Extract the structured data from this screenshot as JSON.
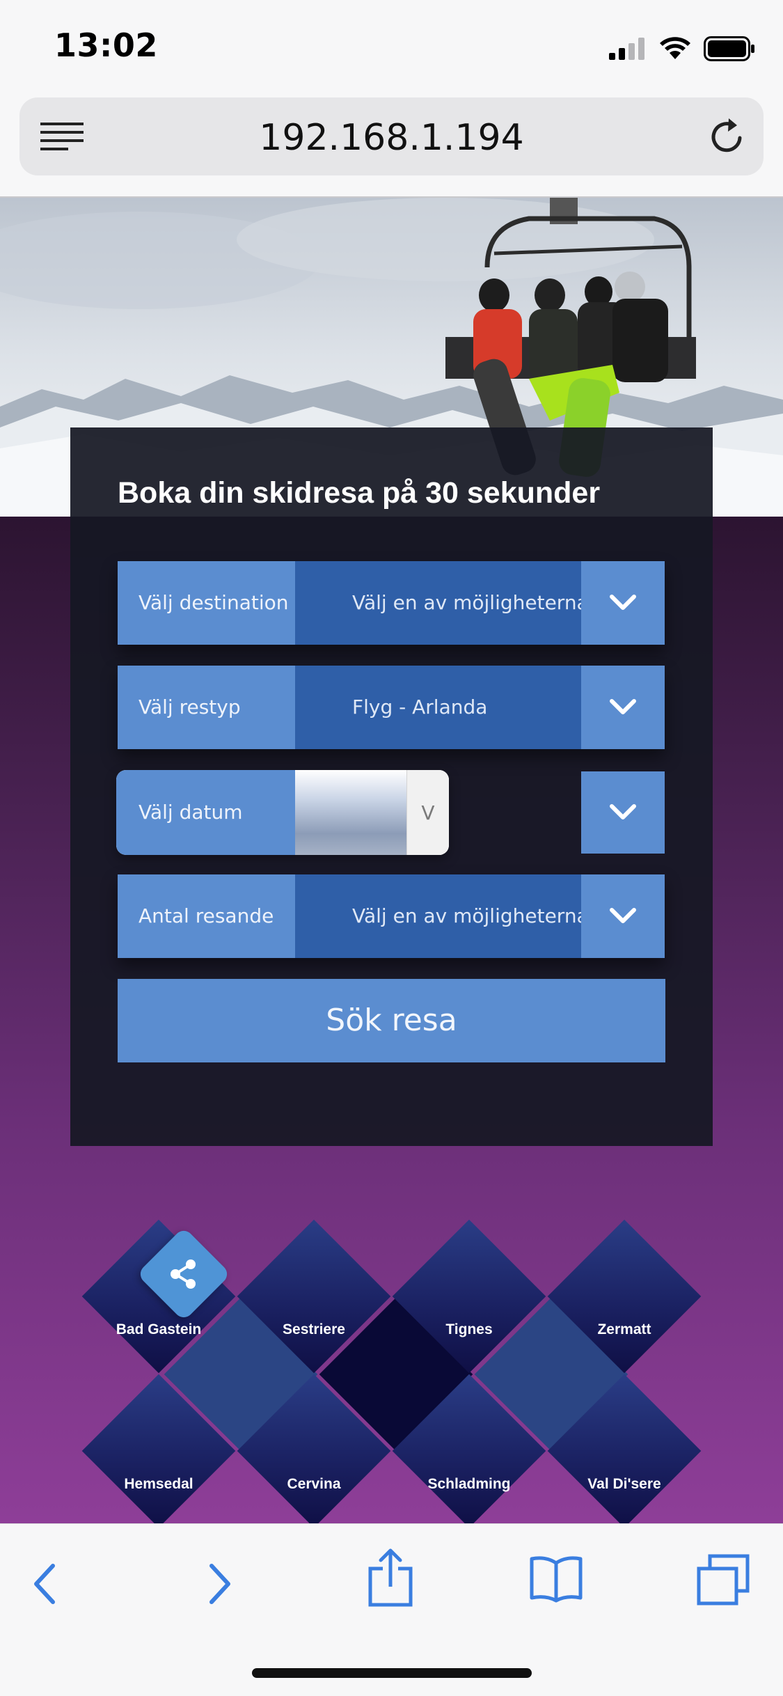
{
  "status_bar": {
    "time": "13:02",
    "signal_icon": "cellular-signal-icon",
    "wifi_icon": "wifi-icon",
    "battery_icon": "battery-icon"
  },
  "browser": {
    "url": "192.168.1.194",
    "menu_icon": "reader-menu-icon",
    "reload_icon": "reload-icon"
  },
  "booking": {
    "title": "Boka din skidresa på 30 sekunder",
    "fields": [
      {
        "label": "Välj destination",
        "value": "Välj en av möjligheterna"
      },
      {
        "label": "Välj restyp",
        "value": "Flyg - Arlanda"
      },
      {
        "label": "Välj datum",
        "value": ""
      },
      {
        "label": "Antal resande",
        "value": "Välj en av möjligheterna"
      }
    ],
    "date_picker_chevron": "V",
    "search_button": "Sök resa"
  },
  "destinations": [
    "Bad Gastein",
    "Sestriere",
    "Tignes",
    "Zermatt",
    "Hemsedal",
    "Cervina",
    "Schladming",
    "Val Di'sere"
  ],
  "share_icon": "share-icon",
  "toolbar": {
    "back_icon": "back-chevron-icon",
    "forward_icon": "forward-chevron-icon",
    "share_icon": "share-upload-icon",
    "bookmarks_icon": "bookmarks-book-icon",
    "tabs_icon": "tabs-icon"
  },
  "colors": {
    "accent_light": "#5b8dd0",
    "accent_dark": "#2f5fa8",
    "panel": "#161824",
    "background_top": "#2c1431",
    "background_bottom": "#8e3e98"
  }
}
